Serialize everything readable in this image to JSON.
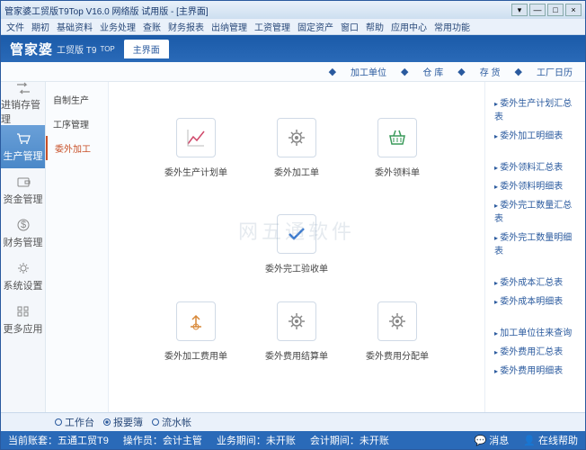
{
  "window": {
    "title": "管家婆工贸版T9Top V16.0 网络版 试用版 - [主界面]"
  },
  "winbtns": {
    "min": "—",
    "max": "□",
    "close": "×",
    "down": "▾"
  },
  "menu": [
    "文件",
    "期初",
    "基础资料",
    "业务处理",
    "查账",
    "财务报表",
    "出纳管理",
    "工资管理",
    "固定资产",
    "窗口",
    "帮助",
    "应用中心",
    "常用功能"
  ],
  "brand": {
    "main": "管家婆",
    "sub": "工贸版 T9",
    "sup": "TOP"
  },
  "tab": "主界面",
  "topactions": [
    "加工单位",
    "仓 库",
    "存 货",
    "工厂日历"
  ],
  "leftnav": [
    {
      "label": "进销存管理"
    },
    {
      "label": "生产管理"
    },
    {
      "label": "资金管理"
    },
    {
      "label": "财务管理"
    },
    {
      "label": "系统设置"
    },
    {
      "label": "更多应用"
    }
  ],
  "submenu": [
    {
      "label": "自制生产"
    },
    {
      "label": "工序管理"
    },
    {
      "label": "委外加工"
    }
  ],
  "cards": [
    {
      "label": "委外生产计划单"
    },
    {
      "label": "委外加工单"
    },
    {
      "label": "委外领料单"
    },
    {
      "label": "委外完工验收单"
    },
    {
      "label": "委外加工费用单"
    },
    {
      "label": "委外费用结算单"
    },
    {
      "label": "委外费用分配单"
    }
  ],
  "rightlinks": [
    [
      "委外生产计划汇总表",
      "委外加工明细表"
    ],
    [
      "委外领料汇总表",
      "委外领料明细表",
      "委外完工数量汇总表",
      "委外完工数量明细表"
    ],
    [
      "委外成本汇总表",
      "委外成本明细表"
    ],
    [
      "加工单位往来查询",
      "委外费用汇总表",
      "委外费用明细表"
    ]
  ],
  "watermark": "网五通软件",
  "bottomtabs": [
    {
      "label": "工作台",
      "on": false
    },
    {
      "label": "报要簿",
      "on": true
    },
    {
      "label": "流水帐",
      "on": false
    }
  ],
  "status": {
    "acct": "当前账套：五通工贸T9",
    "oper": "操作员：会计主管",
    "bizdate": "业务期间：未开账",
    "acctdate": "会计期间：未开账",
    "msg": "消息",
    "help": "在线帮助"
  }
}
